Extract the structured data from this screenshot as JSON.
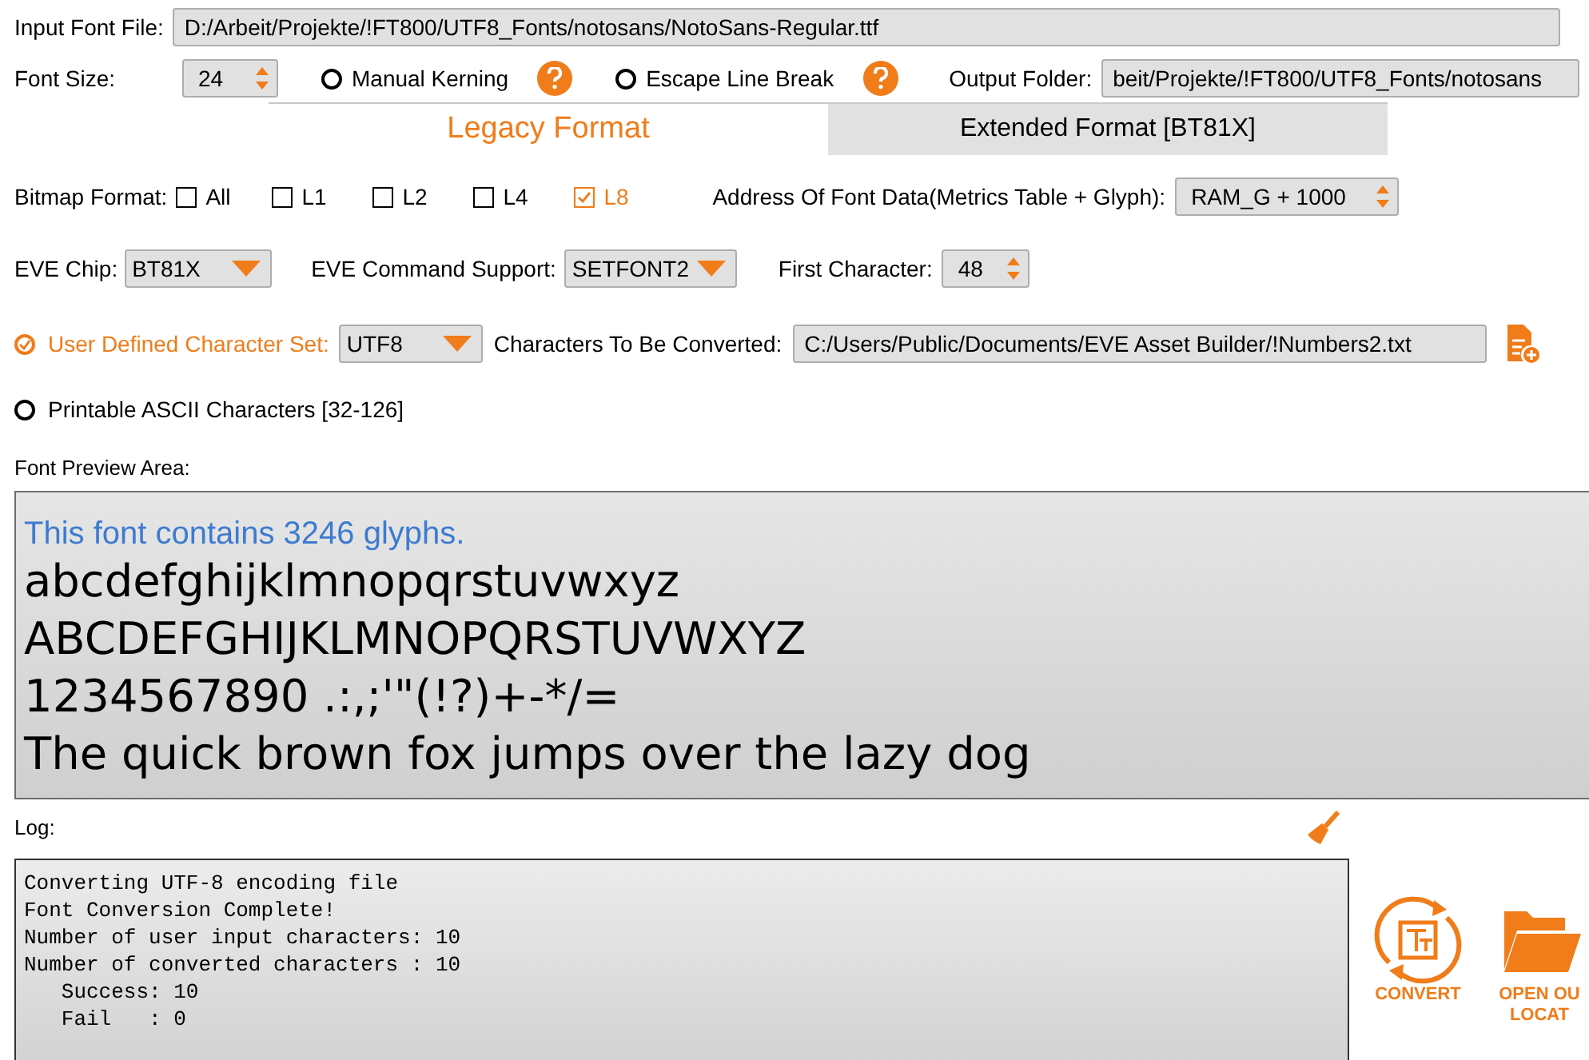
{
  "input_font_file": {
    "label": "Input Font File:",
    "value": "D:/Arbeit/Projekte/!FT800/UTF8_Fonts/notosans/NotoSans-Regular.ttf"
  },
  "font_size": {
    "label": "Font Size:",
    "value": "24"
  },
  "options": [
    {
      "label": "Manual Kerning",
      "checked": false
    },
    {
      "label": "Escape Line Break",
      "checked": false
    }
  ],
  "output_folder": {
    "label": "Output Folder:",
    "value": "beit/Projekte/!FT800/UTF8_Fonts/notosans"
  },
  "format_tabs": [
    {
      "label": "Legacy Format",
      "selected": true
    },
    {
      "label": "Extended Format [BT81X]",
      "selected": false
    }
  ],
  "bitmap_format": {
    "label": "Bitmap Format:",
    "options": [
      {
        "label": "All",
        "checked": false
      },
      {
        "label": "L1",
        "checked": false
      },
      {
        "label": "L2",
        "checked": false
      },
      {
        "label": "L4",
        "checked": false
      },
      {
        "label": "L8",
        "checked": true
      }
    ]
  },
  "address": {
    "label": "Address Of Font Data(Metrics Table + Glyph):",
    "value": "RAM_G + 1000"
  },
  "eve_chip": {
    "label": "EVE Chip:",
    "value": "BT81X"
  },
  "command_support": {
    "label": "EVE Command Support:",
    "value": "SETFONT2"
  },
  "first_character": {
    "label": "First Character:",
    "value": "48"
  },
  "character_sets": [
    {
      "kind": "user_defined",
      "label": "User Defined Character Set:",
      "selected": true,
      "encoding": "UTF8",
      "file_label": "Characters To Be Converted:",
      "file": "C:/Users/Public/Documents/EVE Asset Builder/!Numbers2.txt"
    },
    {
      "kind": "ascii",
      "label": "Printable ASCII Characters [32-126]",
      "selected": false
    }
  ],
  "preview": {
    "label": "Font Preview Area:",
    "summary": "This font contains 3246 glyphs.",
    "lines": [
      "abcdefghijklmnopqrstuvwxyz",
      "ABCDEFGHIJKLMNOPQRSTUVWXYZ",
      "1234567890 .:,;'\"(!?)+-*/=",
      "The quick brown fox jumps over the lazy dog"
    ]
  },
  "log": {
    "label": "Log:",
    "lines": [
      "Converting UTF-8 encoding file",
      "Font Conversion Complete!",
      "Number of user input characters: 10",
      "Number of converted characters : 10",
      "   Success: 10",
      "   Fail   : 0"
    ]
  },
  "actions": [
    {
      "kind": "convert",
      "lines": [
        "CONVERT"
      ]
    },
    {
      "kind": "open",
      "lines": [
        "OPEN OU",
        "LOCAT"
      ]
    }
  ]
}
